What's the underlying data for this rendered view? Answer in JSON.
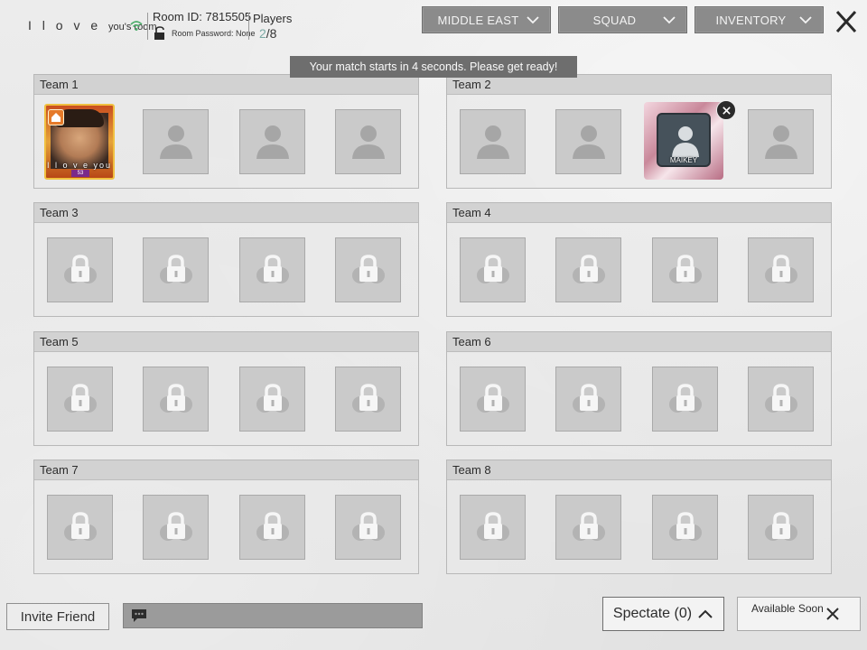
{
  "header": {
    "room_name_main": "I l o v e",
    "room_name_suffix": "you's room",
    "room_id": "Room ID: 7815505",
    "room_password": "Room Password: None",
    "players_label": "Players",
    "players_current": "2",
    "players_total": "/8"
  },
  "filters": {
    "map": "MIDDLE EAST",
    "mode": "SQUAD",
    "inventory": "INVENTORY"
  },
  "notice": "Your match starts in 4 seconds. Please get ready!",
  "teams": [
    {
      "label": "Team 1"
    },
    {
      "label": "Team 2"
    },
    {
      "label": "Team 3"
    },
    {
      "label": "Team 4"
    },
    {
      "label": "Team 5"
    },
    {
      "label": "Team 6"
    },
    {
      "label": "Team 7"
    },
    {
      "label": "Team 8"
    }
  ],
  "players": {
    "p1": {
      "name": "I l o v e you",
      "level": "53"
    },
    "p2": {
      "name": "MAIKEY"
    }
  },
  "bottom": {
    "invite": "Invite Friend",
    "spectate": "Spectate (0)",
    "available": "Available Soon"
  },
  "icons": {
    "wifi": "wifi-icon",
    "lock": "lock-icon",
    "person": "person-icon",
    "close": "close-icon",
    "chevron": "chevron-down-icon",
    "chat": "chat-icon",
    "home": "home-icon"
  }
}
